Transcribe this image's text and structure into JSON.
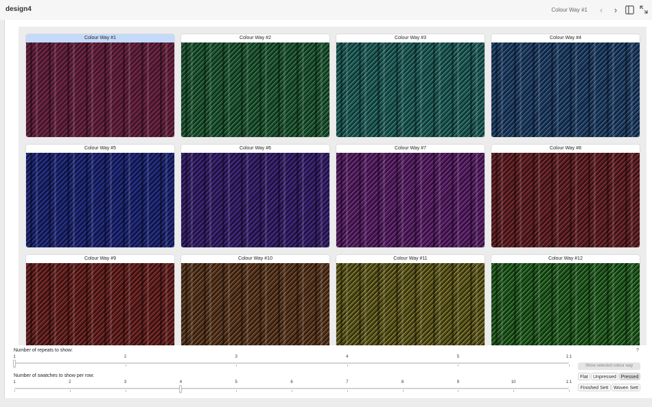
{
  "window": {
    "app_title": "design4",
    "nav_title": "Colour Way #1"
  },
  "swatches": [
    {
      "label": "Colour Way #1",
      "colors": [
        "#5b1f38",
        "#8a2f58",
        "#3a1424"
      ],
      "selected": true
    },
    {
      "label": "Colour Way #2",
      "colors": [
        "#1e4d2e",
        "#3a8a54",
        "#0f2c1a"
      ],
      "selected": false
    },
    {
      "label": "Colour Way #3",
      "colors": [
        "#1f5350",
        "#3d8f88",
        "#0f3230"
      ],
      "selected": false
    },
    {
      "label": "Colour Way #4",
      "colors": [
        "#1f3858",
        "#3e6c9d",
        "#0f1f36"
      ],
      "selected": false
    },
    {
      "label": "Colour Way #5",
      "colors": [
        "#1d2466",
        "#3341a6",
        "#0d1140"
      ],
      "selected": false
    },
    {
      "label": "Colour Way #6",
      "colors": [
        "#321d5c",
        "#5535a3",
        "#1a0f36"
      ],
      "selected": false
    },
    {
      "label": "Colour Way #7",
      "colors": [
        "#4f1f5a",
        "#88399a",
        "#2c0f34"
      ],
      "selected": false
    },
    {
      "label": "Colour Way #8",
      "colors": [
        "#561f24",
        "#96383a",
        "#300f12"
      ],
      "selected": false
    },
    {
      "label": "Colour Way #9",
      "colors": [
        "#5a1f20",
        "#9b3a33",
        "#320f10"
      ],
      "selected": false
    },
    {
      "label": "Colour Way #10",
      "colors": [
        "#4e3220",
        "#8f5e36",
        "#2c1a0e"
      ],
      "selected": false
    },
    {
      "label": "Colour Way #11",
      "colors": [
        "#55501e",
        "#9a8f36",
        "#302c0e"
      ],
      "selected": false
    },
    {
      "label": "Colour Way #12",
      "colors": [
        "#224f22",
        "#449a3a",
        "#102e10"
      ],
      "selected": false
    }
  ],
  "controls": {
    "repeats": {
      "label": "Number of repeats to show:",
      "ticks": [
        "1",
        "2",
        "3",
        "4",
        "5",
        "1:1"
      ],
      "value": "1"
    },
    "swatches_per_row": {
      "label": "Number of swatches to show per row:",
      "ticks": [
        "1",
        "2",
        "3",
        "4",
        "5",
        "6",
        "7",
        "8",
        "9",
        "10",
        "1:1"
      ],
      "value": "4"
    },
    "help_label": "?",
    "show_selected_label": "Show selected colour way",
    "press_options": [
      {
        "label": "Flat",
        "active": false
      },
      {
        "label": "Unpressed",
        "active": false
      },
      {
        "label": "Pressed",
        "active": true
      }
    ],
    "sett_options": [
      {
        "label": "Finished Sett",
        "active": false
      },
      {
        "label": "Woven Sett",
        "active": false
      }
    ]
  }
}
